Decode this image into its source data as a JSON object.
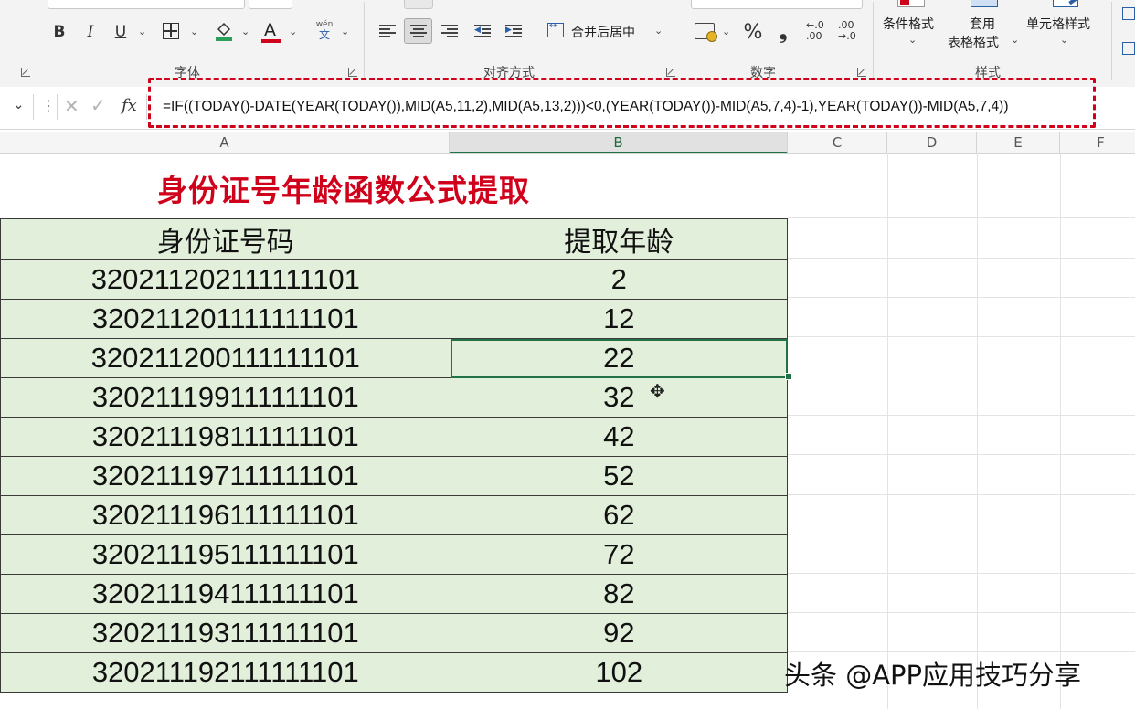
{
  "ribbon": {
    "groups": {
      "font": "字体",
      "alignment": "对齐方式",
      "number": "数字",
      "styles": "样式"
    },
    "font": {
      "bold": "B",
      "italic": "I",
      "underline": "U",
      "font_color_glyph": "A",
      "phonetic_top": "wén",
      "phonetic_bottom": "文"
    },
    "alignment": {
      "merge_center": "合并后居中"
    },
    "number": {
      "percent": "%",
      "comma": "❟",
      "increase_decimal": "←.0\n.00",
      "decrease_decimal": ".00\n→.0"
    },
    "styles": {
      "conditional_format": "条件格式",
      "table_format_line1": "套用",
      "table_format_line2": "表格格式",
      "cell_styles": "单元格样式"
    }
  },
  "formula_bar": {
    "fx": "fx",
    "formula": "=IF((TODAY()-DATE(YEAR(TODAY()),MID(A5,11,2),MID(A5,13,2)))<0,(YEAR(TODAY())-MID(A5,7,4)-1),YEAR(TODAY())-MID(A5,7,4))"
  },
  "columns": [
    "A",
    "B",
    "C",
    "D",
    "E",
    "F"
  ],
  "sheet": {
    "title": "身份证号年龄函数公式提取",
    "header": [
      "身份证号码",
      "提取年龄"
    ],
    "rows": [
      [
        "320211202111111101",
        "2"
      ],
      [
        "320211201111111101",
        "12"
      ],
      [
        "320211200111111101",
        "22"
      ],
      [
        "320211199111111101",
        "32"
      ],
      [
        "320211198111111101",
        "42"
      ],
      [
        "320211197111111101",
        "52"
      ],
      [
        "320211196111111101",
        "62"
      ],
      [
        "320211195111111101",
        "72"
      ],
      [
        "320211194111111101",
        "82"
      ],
      [
        "320211193111111101",
        "92"
      ],
      [
        "320211192111111101",
        "102"
      ]
    ]
  },
  "watermark": "头条 @APP应用技巧分享",
  "colors": {
    "title_red": "#d0021b",
    "cell_fill": "#e2efda",
    "selection_green": "#217346",
    "highlight_box": "#d0021b"
  }
}
